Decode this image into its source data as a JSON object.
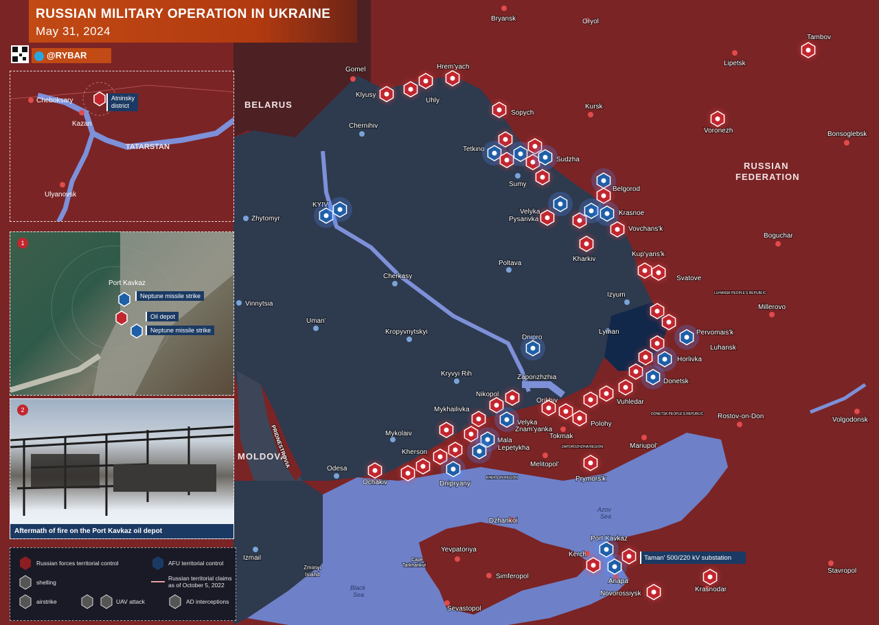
{
  "header": {
    "title": "RUSSIAN MILITARY OPERATION IN UKRAINE",
    "date": "May 31, 2024",
    "brand": "@RYBAR"
  },
  "colors": {
    "russia": "#7a2426",
    "ukraine": "#2e3a4e",
    "afu_front": "#12284a",
    "sea": "#6e80c8",
    "river": "#7d90d8",
    "accent_red": "#c2262e",
    "accent_blue": "#1f5fa8",
    "header_orange": "#c24a14"
  },
  "regions": {
    "belarus": "BELARUS",
    "moldova": "MOLDOVA",
    "russia_line1": "RUSSIAN",
    "russia_line2": "FEDERATION",
    "tatarstan": "TATARSTAN",
    "azov": "Azov",
    "azov2": "Sea",
    "black": "Black",
    "black2": "Sea",
    "transnistria": "PRIDNESTROVIA",
    "cape": "Cape",
    "cape2": "Tarkhankut",
    "zmiiny": "Zmiinyi",
    "zmiiny2": "Island",
    "dpr": "DONETSK PEOPLE'S REPUBLIC",
    "lpr": "LUHANSK PEOPLE'S REPUBLIC",
    "zap_region": "ZAPOROZHZHIA REGION",
    "kherson_region": "KHERSON REGION"
  },
  "cities": {
    "bryansk": "Bryansk",
    "oryol": "Oryol",
    "tambov": "Tambov",
    "lipetsk": "Lipetsk",
    "gomel": "Gomel",
    "hremyach": "Hrem'yach",
    "klyusy": "Klyusy",
    "uhly": "Uhly",
    "sopych": "Sopych",
    "kursk": "Kursk",
    "voronezh": "Voronezh",
    "borisoglebsk": "Borisoglebsk",
    "chernihiv": "Chernihiv",
    "tetkino": "Tetkino",
    "sudzha": "Sudzha",
    "sumy": "Sumy",
    "belgorod": "Belgorod",
    "kyiv": "KYIV",
    "zhytomyr": "Zhytomyr",
    "velyka": "Velyka",
    "pysarivka": "Pysarivka",
    "krasnoe": "Krasnoe",
    "vovchansk": "Vovchans'k",
    "boguchar": "Boguchar",
    "poltava": "Poltava",
    "kharkiv": "Kharkiv",
    "kupyansk": "Kup'yans'k",
    "svatove": "Svatove",
    "cherkasy": "Cherkasy",
    "vinnytsia": "Vinnytsia",
    "izyum": "Izyum",
    "millerovo": "Millerovo",
    "uman": "Uman'",
    "lyman": "Lyman",
    "pervomaisk": "Pervomais'k",
    "luhansk": "Luhansk",
    "kropyvnytskyi": "Kropyvnytskyi",
    "dnipro": "Dnipro",
    "horlivka": "Horlivka",
    "donetsk": "Donetsk",
    "kryvyi_rih": "Kryvyi Rih",
    "zaporizhzhia": "Zaporizhzhia",
    "vuhledar": "Vuhledar",
    "nikopol": "Nikopol",
    "rostov": "Rostov-on-Don",
    "volgodonsk": "Volgodonsk",
    "mykhailivka": "Mykhailivka",
    "orikhiv": "Orikhiv",
    "velyka_zn": "Velyka",
    "znamyanka": "Znam'yanka",
    "polohy": "Polohy",
    "tokmak": "Tokmak",
    "mykolaiv": "Mykolaiv",
    "mala": "Mala",
    "lepetykha": "Lepetykha",
    "mariupol": "Mariupol'",
    "kherson": "Kherson",
    "melitopol": "Melitopol'",
    "odesa": "Odesa",
    "ochakiv": "Ochakiv",
    "dnipryany": "Dnipryany",
    "prymorsk": "Prymors'k",
    "dzhankoi": "Dzhankoi",
    "yevpatoriya": "Yevpatoriya",
    "port_kavkaz": "Port Kavkaz",
    "kerch": "Kerch",
    "izmail": "Izmail",
    "simferopol": "Simferopol",
    "anapa": "Anapa",
    "novorossiysk": "Novorossiysk",
    "krasnodar": "Krasnodar",
    "stavropol": "Stavropol",
    "sevastopol": "Sevastopol"
  },
  "callouts": {
    "taman": "Taman' 500/220 kV substation"
  },
  "inset_tatarstan": {
    "cheboksary": "Cheboksary",
    "kazan": "Kazan",
    "ulyanovsk": "Ulyanovsk",
    "atninsky1": "Atninsky",
    "atninsky2": "district"
  },
  "inset_port": {
    "number": "1",
    "port": "Port Kavkaz",
    "neptune1": "Neptune missile strike",
    "oil": "Oil depot",
    "neptune2": "Neptune missile strike"
  },
  "inset_photo": {
    "number": "2",
    "caption": "Aftermath of fire on the Port Kavkaz oil depot"
  },
  "legend": {
    "russian": "Russian forces territorial control",
    "afu": "AFU territorial control",
    "shelling": "shelling",
    "claims1": "Russian territorial claims",
    "claims2": "as of October 5, 2022",
    "airstrike": "airstrike",
    "uav": "UAV attack",
    "ad": "AD interceptions"
  }
}
